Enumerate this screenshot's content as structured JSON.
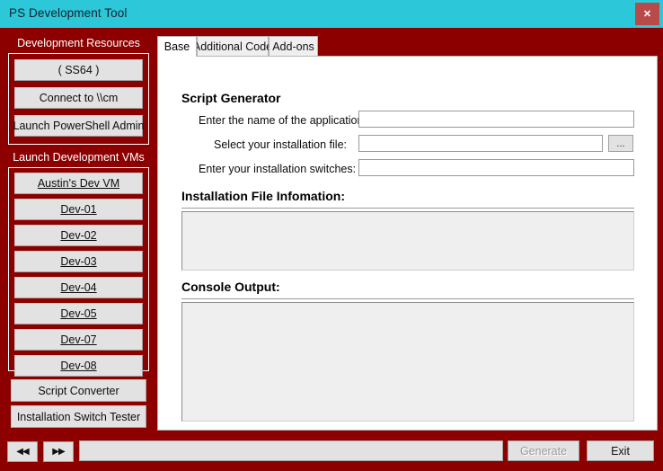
{
  "window": {
    "title": "PS Development Tool",
    "close_label": "✕",
    "titlebar_color": "#2cc7d8",
    "body_color": "#8c0000"
  },
  "sidebar": {
    "groups": [
      {
        "label": "Development Resources",
        "buttons": [
          {
            "label": "( SS64 )",
            "link": false
          },
          {
            "label": "Connect to \\\\cm",
            "link": false
          },
          {
            "label": "Launch PowerShell Admin",
            "link": false
          }
        ]
      },
      {
        "label": "Launch Development VMs",
        "buttons": [
          {
            "label": "Austin's Dev VM",
            "link": true
          },
          {
            "label": "Dev-01",
            "link": true
          },
          {
            "label": "Dev-02",
            "link": true
          },
          {
            "label": "Dev-03",
            "link": true
          },
          {
            "label": "Dev-04",
            "link": true
          },
          {
            "label": "Dev-05",
            "link": true
          },
          {
            "label": "Dev-07",
            "link": true
          },
          {
            "label": "Dev-08",
            "link": true
          }
        ]
      }
    ],
    "free_buttons": [
      {
        "label": "Script Converter"
      },
      {
        "label": "Installation Switch Tester"
      }
    ]
  },
  "main": {
    "tabs": [
      {
        "label": "Base",
        "active": true
      },
      {
        "label": "Additional Code",
        "active": false
      },
      {
        "label": "Add-ons",
        "active": false
      }
    ],
    "script_generator": {
      "title": "Script Generator",
      "fields": [
        {
          "label": "Enter the name of the application:",
          "value": "",
          "placeholder": "",
          "has_browse": false
        },
        {
          "label": "Select your installation file:",
          "value": "",
          "placeholder": "",
          "has_browse": true,
          "browse_label": "..."
        },
        {
          "label": "Enter your installation switches:",
          "value": "",
          "placeholder": "",
          "has_browse": false
        }
      ]
    },
    "install_info": {
      "title": "Installation File Infomation:",
      "content": ""
    },
    "console": {
      "title": "Console Output:",
      "content": ""
    }
  },
  "bottombar": {
    "nav_back_label": "◀◀",
    "nav_forward_label": "▶▶",
    "status_text": "",
    "generate_label": "Generate",
    "generate_enabled": false,
    "exit_label": "Exit"
  }
}
